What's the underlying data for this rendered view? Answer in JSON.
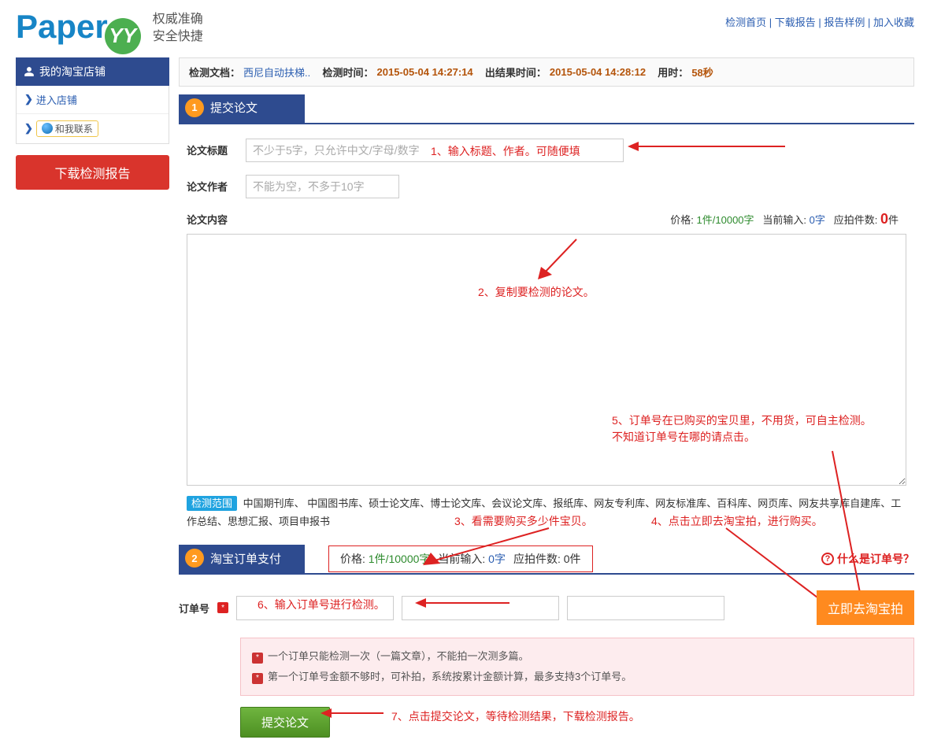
{
  "top_nav": {
    "items": [
      "检测首页",
      "下载报告",
      "报告样例",
      "加入收藏"
    ]
  },
  "logo": {
    "text": "Paper",
    "badge": "YY",
    "slogan1": "权威准确",
    "slogan2": "安全快捷"
  },
  "sidebar": {
    "title": "我的淘宝店铺",
    "enter": "进入店铺",
    "contact": "和我联系",
    "download_btn": "下载检测报告"
  },
  "info_bar": {
    "doc_lbl": "检测文档：",
    "doc_val": "西尼自动扶梯..",
    "det_lbl": "检测时间：",
    "det_val": "2015-05-04 14:27:14",
    "res_lbl": "出结果时间：",
    "res_val": "2015-05-04 14:28:12",
    "dur_lbl": "用时：",
    "dur_val": "58秒"
  },
  "step1": {
    "title": "提交论文",
    "title_lbl": "论文标题",
    "title_ph": "不少于5字，只允许中文/字母/数字",
    "author_lbl": "论文作者",
    "author_ph": "不能为空，不多于10字",
    "content_lbl": "论文内容",
    "price_lbl": "价格:",
    "price_val": "1件/10000字",
    "cur_lbl": "当前输入:",
    "cur_val": "0字",
    "cnt_lbl": "应拍件数:",
    "cnt_val": "0",
    "cnt_unit": "件",
    "scope_tag": "检测范围",
    "scope_text": "中国期刊库、 中国图书库、硕士论文库、博士论文库、会议论文库、报纸库、网友专利库、网友标准库、百科库、网页库、网友共享库自建库、工作总结、思想汇报、项目申报书"
  },
  "step2": {
    "title": "淘宝订单支付",
    "help": "什么是订单号？",
    "order_lbl": "订单号",
    "taobao_btn": "立即去淘宝拍",
    "warn1": "一个订单只能检测一次（一篇文章），不能拍一次测多篇。",
    "warn2": "第一个订单号金额不够时，可补拍，系统按累计金额计算，最多支持3个订单号。",
    "submit_btn": "提交论文"
  },
  "anno": {
    "a1": "1、输入标题、作者。可随便填",
    "a2": "2、复制要检测的论文。",
    "a3": "3、看需要购买多少件宝贝。",
    "a4": "4、点击立即去淘宝拍，进行购买。",
    "a5a": "5、订单号在已购买的宝贝里，不用货，可自主检测。",
    "a5b": "不知道订单号在哪的请点击。",
    "a6": "6、输入订单号进行检测。",
    "a7": "7、点击提交论文，等待检测结果，下载检测报告。"
  }
}
